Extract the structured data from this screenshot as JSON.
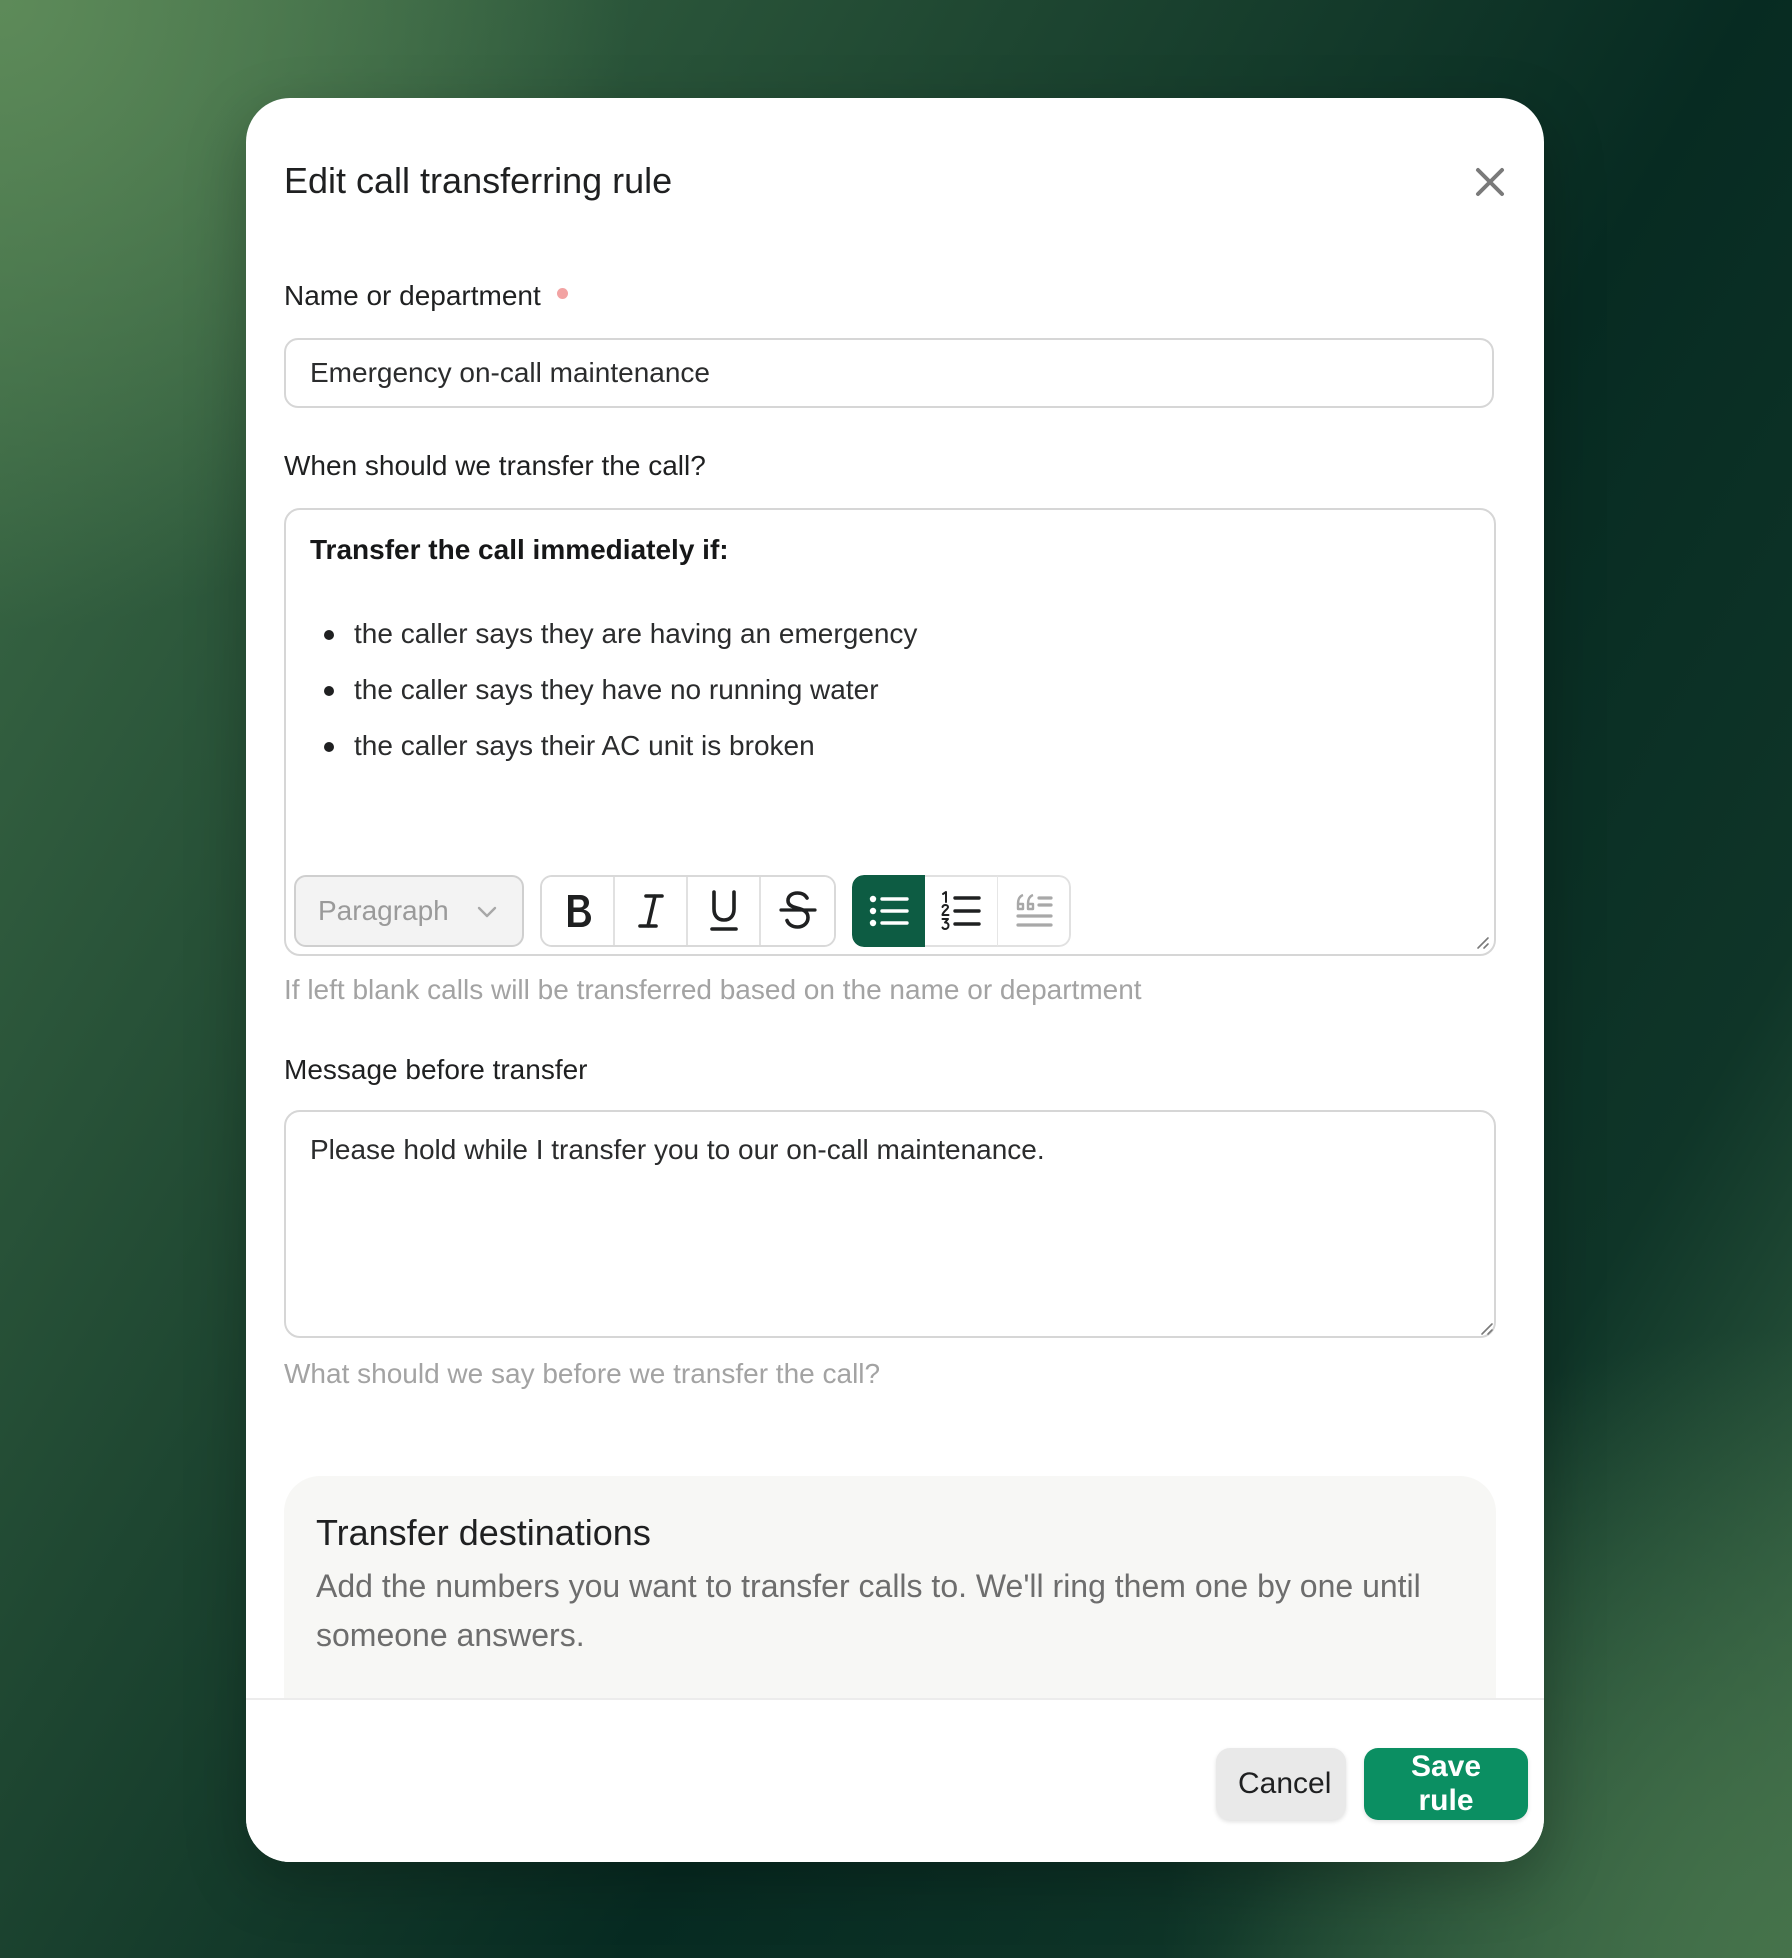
{
  "modal": {
    "title": "Edit call transferring rule",
    "close_icon": "close-icon"
  },
  "name_field": {
    "label": "Name or department",
    "required_indicator_color": "#f2a3a3",
    "value": "Emergency on-call maintenance"
  },
  "transfer_condition": {
    "label": "When should we transfer the call?",
    "editor": {
      "heading": "Transfer the call immediately if:",
      "bullets": [
        "the caller says they are having an emergency",
        "the caller says they have no running water",
        "the caller says their AC unit is broken"
      ]
    },
    "toolbar": {
      "block_type": "Paragraph",
      "buttons": [
        {
          "icon": "bold-icon",
          "active": false
        },
        {
          "icon": "italic-icon",
          "active": false
        },
        {
          "icon": "underline-icon",
          "active": false
        },
        {
          "icon": "strikethrough-icon",
          "active": false
        },
        {
          "icon": "bullet-list-icon",
          "active": true
        },
        {
          "icon": "numbered-list-icon",
          "active": false
        },
        {
          "icon": "quote-icon",
          "active": false
        }
      ],
      "active_color": "#0d5c43"
    },
    "helper": "If left blank calls will be transferred based on the name or department"
  },
  "message_field": {
    "label": "Message before transfer",
    "value": "Please hold while I transfer you to our on-call maintenance.",
    "helper": "What should we say before we transfer the call?"
  },
  "transfer_destinations": {
    "title": "Transfer destinations",
    "description": "Add the numbers you want to transfer calls to. We'll ring them one by one until someone answers."
  },
  "footer": {
    "cancel_label": "Cancel",
    "save_label": "Save rule",
    "save_color": "#0b8f62"
  }
}
